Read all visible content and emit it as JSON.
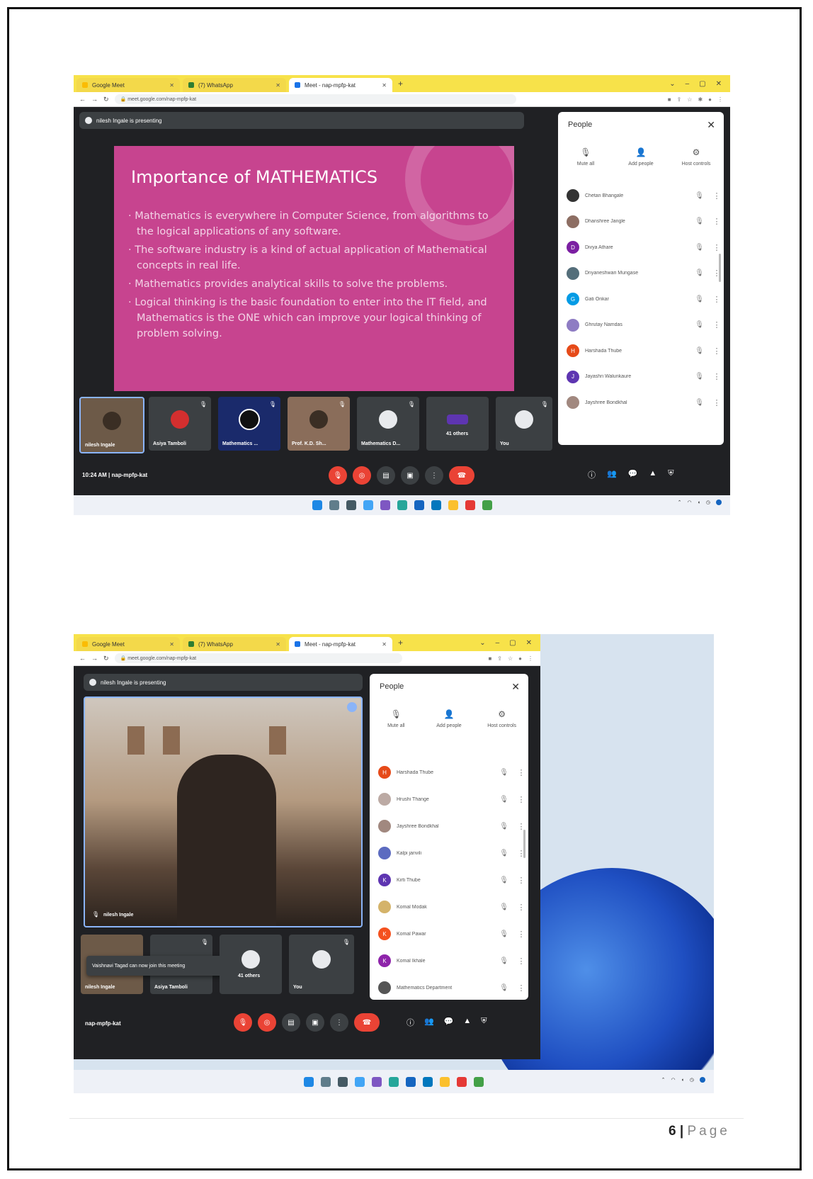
{
  "screenshot1": {
    "tabs": [
      "Google Meet",
      "(7) WhatsApp",
      "Meet - nap-mpfp-kat"
    ],
    "url": "meet.google.com/nap-mpfp-kat",
    "presenting_banner": "nilesh Ingale is presenting",
    "slide": {
      "title": "Importance of MATHEMATICS",
      "bullets": [
        "Mathematics is everywhere in Computer Science, from algorithms to the logical applications of any software.",
        "The software industry is a kind of actual application of Mathematical concepts in real life.",
        "Mathematics provides analytical skills to solve the problems.",
        "Logical thinking is the basic foundation to enter into the IT field, and Mathematics is the ONE which can improve your logical thinking of problem solving."
      ]
    },
    "people_panel": {
      "title": "People",
      "actions": [
        "Mute all",
        "Add people",
        "Host controls"
      ],
      "participants": [
        {
          "name": "Chetan Bhangale",
          "initial": "",
          "color": "#333333"
        },
        {
          "name": "Dhanshree Jangle",
          "initial": "",
          "color": "#8d6e63"
        },
        {
          "name": "Divya Athare",
          "initial": "D",
          "color": "#7b1fa2"
        },
        {
          "name": "Dnyaneshwari Mungase",
          "initial": "",
          "color": "#546e7a"
        },
        {
          "name": "Gati Onkar",
          "initial": "G",
          "color": "#039be5"
        },
        {
          "name": "Ghrutay Namdas",
          "initial": "",
          "color": "#8e7cc3"
        },
        {
          "name": "Harshada Thube",
          "initial": "H",
          "color": "#e64a19"
        },
        {
          "name": "Jayashri Walunkaure",
          "initial": "J",
          "color": "#5e35b1"
        },
        {
          "name": "Jayshree Bondkhal",
          "initial": "",
          "color": "#a1887f"
        }
      ]
    },
    "tiles": [
      "nilesh Ingale",
      "Asiya Tamboli",
      "Mathematics ...",
      "Prof. K.D. Sh...",
      "Mathematics D...",
      "41 others",
      "You"
    ],
    "meeting_info": "10:24 AM  |  nap-mpfp-kat"
  },
  "screenshot2": {
    "tabs": [
      "Google Meet",
      "(7) WhatsApp",
      "Meet - nap-mpfp-kat"
    ],
    "url": "meet.google.com/nap-mpfp-kat",
    "presenting_banner": "nilesh Ingale is presenting",
    "main_video_name": "nilesh Ingale",
    "people_panel": {
      "title": "People",
      "actions": [
        "Mute all",
        "Add people",
        "Host controls"
      ],
      "participants": [
        {
          "name": "Harshada Thube",
          "initial": "H",
          "color": "#e64a19"
        },
        {
          "name": "Hrushi Thange",
          "initial": "",
          "color": "#bcaaa4"
        },
        {
          "name": "Jayshree Bondkhal",
          "initial": "",
          "color": "#a1887f"
        },
        {
          "name": "Kalpi janvili",
          "initial": "",
          "color": "#5c6bc0"
        },
        {
          "name": "Kirti Thube",
          "initial": "K",
          "color": "#5e35b1"
        },
        {
          "name": "Komal Modak",
          "initial": "",
          "color": "#d4b36a"
        },
        {
          "name": "Komal Pawar",
          "initial": "K",
          "color": "#f4511e"
        },
        {
          "name": "Komal Ikhale",
          "initial": "K",
          "color": "#8e24aa"
        },
        {
          "name": "Mathematics Department",
          "initial": "",
          "color": "#555555"
        }
      ]
    },
    "toast": "Vaishnavi Tagad can now join this meeting",
    "tiles": [
      "nilesh Ingale",
      "Asiya Tamboli",
      "41 others",
      "You"
    ],
    "meeting_info": "nap-mpfp-kat"
  },
  "footer": {
    "page_number": "6",
    "separator": "|",
    "page_label": "Page"
  }
}
